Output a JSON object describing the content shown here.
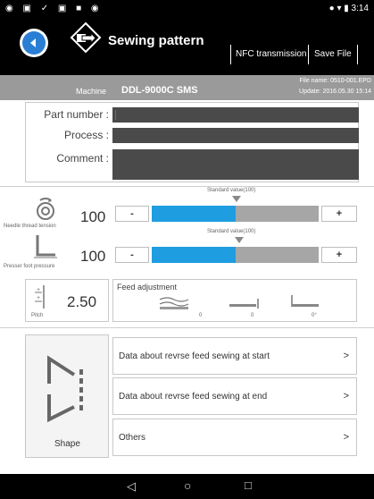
{
  "status_bar": {
    "left_icons": "◉ ▣ ✓ ▣ ■ ◉",
    "right": "● ▾ ▮ 3:14"
  },
  "header": {
    "title": "Sewing pattern",
    "nfc_label": "NFC transmission",
    "save_label": "Save File",
    "accent": "#2a7fd4"
  },
  "machine_bar": {
    "label": "Machine",
    "name": "DDL-9000C SMS",
    "file_name": "File name: 0510-001.EPD",
    "update": "Update: 2016.05.30 15:14"
  },
  "fields": {
    "part_number_label": "Part number :",
    "process_label": "Process :",
    "comment_label": "Comment :",
    "part_number_value": "",
    "process_value": "",
    "comment_value": ""
  },
  "thread_tension": {
    "standard_label": "Standard value(100)",
    "value": "100",
    "caption": "Needle thread tension",
    "minus": "-",
    "plus": "+",
    "level": 0.5
  },
  "presser_pressure": {
    "standard_label": "Standard value(100)",
    "value": "100",
    "caption": "Presser foot pressure",
    "minus": "-",
    "plus": "+",
    "level": 0.5
  },
  "pitch": {
    "value": "2.50",
    "caption": "Pitch"
  },
  "feed": {
    "title": "Feed adjustment",
    "items": [
      {
        "value": "0"
      },
      {
        "value": "0"
      },
      {
        "value": "0°"
      }
    ]
  },
  "shape": {
    "caption": "Shape"
  },
  "menu": [
    {
      "label": "Data about revrse feed sewing at start",
      "chev": ">"
    },
    {
      "label": "Data about revrse feed sewing at end",
      "chev": ">"
    },
    {
      "label": "Others",
      "chev": ">"
    }
  ],
  "nav": {
    "back": "◁",
    "home": "○",
    "recents": "□"
  }
}
